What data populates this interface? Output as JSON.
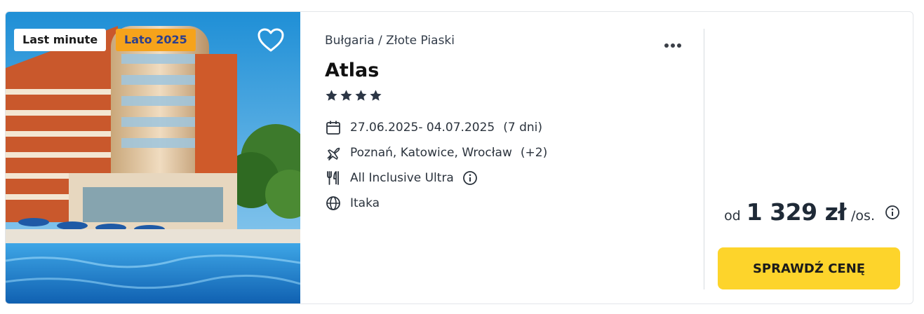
{
  "offer": {
    "badges": {
      "last_minute": "Last minute",
      "season": "Lato 2025"
    },
    "location": "Bułgaria / Złote Piaski",
    "hotel_name": "Atlas",
    "stars": 4,
    "dates": "27.06.2025- 04.07.2025",
    "duration": "(7 dni)",
    "departures": "Poznań, Katowice, Wrocław",
    "departures_more": "(+2)",
    "board": "All Inclusive Ultra",
    "operator": "Itaka",
    "price": {
      "prefix": "od",
      "amount": "1 329 zł",
      "unit": "/os."
    },
    "cta_label": "SPRAWDŹ CENĘ"
  },
  "colors": {
    "accent_yellow": "#fdd42b",
    "badge_orange": "#f6a31b",
    "badge_season_text": "#2d3f8c",
    "text_dark": "#1f2a37"
  },
  "icons": [
    "heart-icon",
    "more-dots-icon",
    "star-icon",
    "calendar-icon",
    "plane-icon",
    "cutlery-icon",
    "info-icon",
    "globe-icon"
  ]
}
